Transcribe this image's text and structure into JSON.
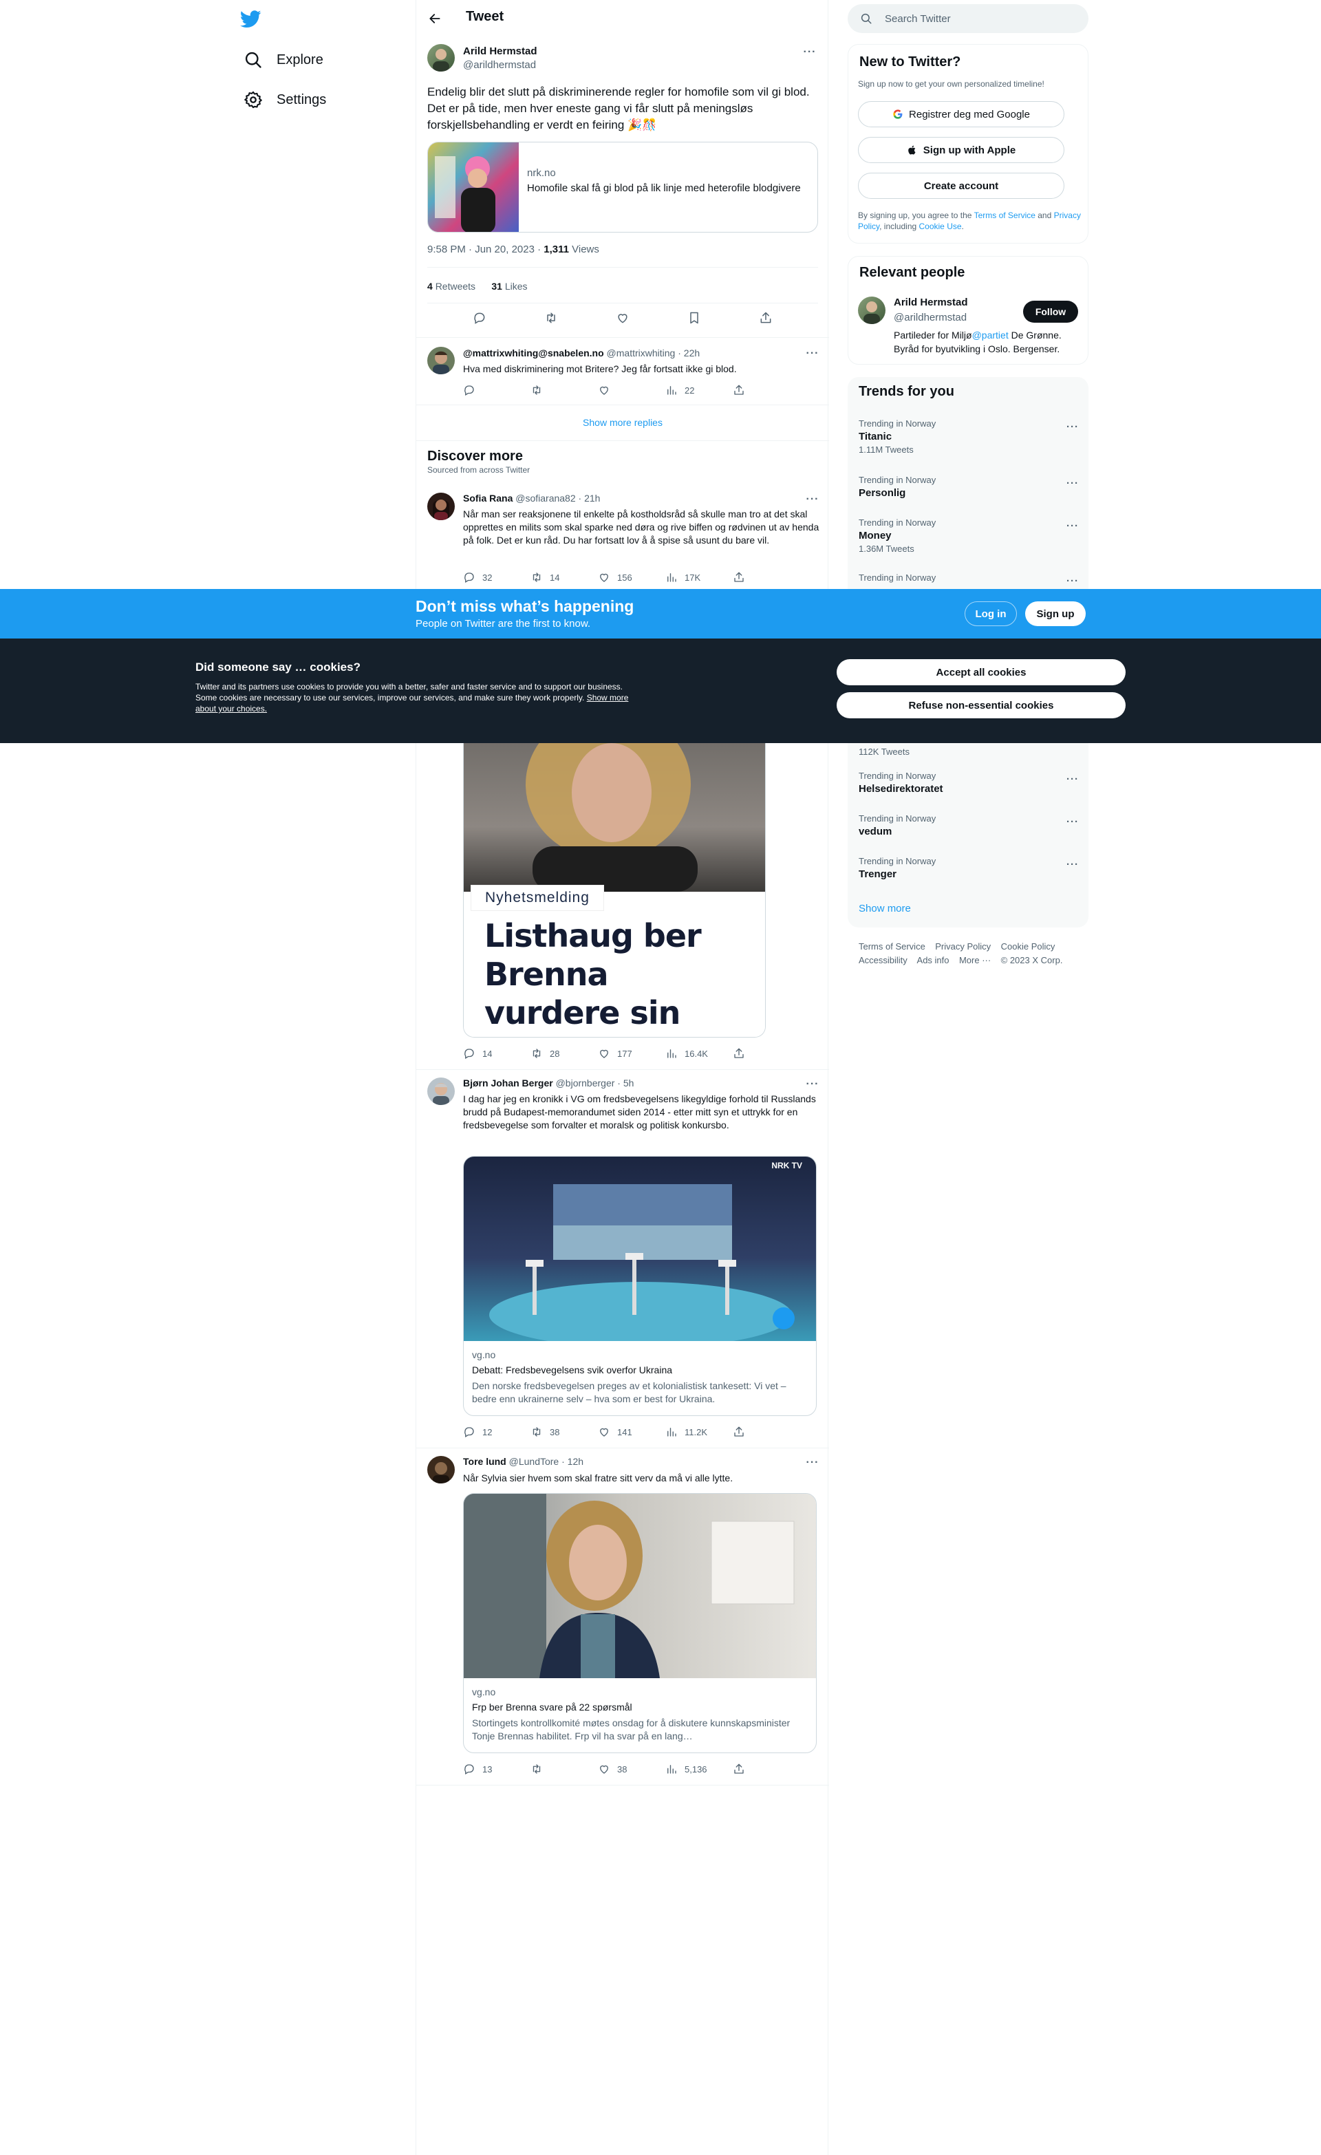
{
  "nav": {
    "explore": "Explore",
    "settings": "Settings"
  },
  "header": {
    "title": "Tweet"
  },
  "main_tweet": {
    "name": "Arild Hermstad",
    "handle": "@arildhermstad",
    "text": "Endelig blir det slutt på diskriminerende regler for homofile som vil gi blod. Det er på tide, men hver eneste gang vi får slutt på meningsløs forskjellsbehandling er verdt en feiring 🎉🎊",
    "card_domain": "nrk.no",
    "card_title": "Homofile skal få gi blod på lik linje med heterofile blodgivere",
    "time": "9:58 PM · Jun 20, 2023 · ",
    "views_count": "1,311",
    "views_label": " Views",
    "retweets_count": "4",
    "retweets_label": "Retweets",
    "likes_count": "31",
    "likes_label": "Likes"
  },
  "reply": {
    "name": "@mattrixwhiting@snabelen.no",
    "handle": "@mattrixwhiting · 22h",
    "text": "Hva med diskriminering mot Britere? Jeg får fortsatt ikke gi blod.",
    "views": "22"
  },
  "show_more_replies": "Show more replies",
  "discover": {
    "title": "Discover more",
    "subtitle": "Sourced from across Twitter"
  },
  "tweets": [
    {
      "name": "Sofia Rana",
      "handle": "@sofiarana82 · 21h",
      "text": "Når man ser reaksjonene til enkelte på kostholdsråd så skulle man tro at det skal opprettes en milits som skal sparke ned døra og rive biffen og rødvinen ut av henda på folk. Det er kun råd. Du har fortsatt lov å å spise så usunt du bare vil.",
      "replies": "32",
      "retweets": "14",
      "likes": "156",
      "views": "17K"
    },
    {
      "image_tag": "Nyhetsmelding",
      "image_headline": "Listhaug ber Brenna vurdere sin stilling",
      "replies": "14",
      "retweets": "28",
      "likes": "177",
      "views": "16.4K"
    },
    {
      "name": "Bjørn Johan Berger",
      "handle": "@bjornberger · 5h",
      "text": "I dag har jeg en kronikk i VG om fredsbevegelsens likegyldige forhold til Russlands brudd på Budapest-memorandumet siden 2014 - etter mitt syn et uttrykk for en fredsbevegelse som forvalter et moralsk og politisk konkursbo.",
      "card_domain": "vg.no",
      "card_title": "Debatt: Fredsbevegelsens svik overfor Ukraina",
      "card_desc": "Den norske fredsbevegelsen preges av et kolonialistisk tankesett: Vi vet – bedre enn ukrainerne selv – hva som er best for Ukraina.",
      "image_brand": "NRK TV",
      "replies": "12",
      "retweets": "38",
      "likes": "141",
      "views": "11.2K"
    },
    {
      "name": "Tore lund",
      "handle": "@LundTore · 12h",
      "text": "Når Sylvia sier hvem som skal fratre sitt verv da må vi alle lytte.",
      "card_domain": "vg.no",
      "card_title": "Frp ber Brenna svare på 22 spørsmål",
      "card_desc": "Stortingets kontrollkomité møtes onsdag for å diskutere kunnskapsminister Tonje Brennas habilitet. Frp vil ha svar på en lang…",
      "replies": "13",
      "retweets": "",
      "likes": "38",
      "views": "5,136"
    }
  ],
  "right": {
    "search_placeholder": "Search Twitter",
    "new_title": "New to Twitter?",
    "new_sub": "Sign up now to get your own personalized timeline!",
    "google_btn": "Registrer deg med Google",
    "apple_btn": "Sign up with Apple",
    "create_btn": "Create account",
    "terms_pre": "By signing up, you agree to the ",
    "terms_link": "Terms of Service",
    "terms_mid": " and ",
    "privacy_link": "Privacy Policy",
    "terms_mid2": ", including ",
    "cookie_link": "Cookie Use",
    "terms_end": ".",
    "relevant_title": "Relevant people",
    "person_name": "Arild Hermstad",
    "person_handle": "@arildhermstad",
    "follow_btn": "Follow",
    "bio_pre": "Partileder for Miljø",
    "bio_link": "@partiet",
    "bio_post": " De Grønne. Byråd for byutvikling i Oslo. Bergenser.",
    "trends_title": "Trends for you",
    "trends": [
      {
        "cat": "Trending in Norway",
        "title": "Titanic",
        "count": "1.11M Tweets"
      },
      {
        "cat": "Trending in Norway",
        "title": "Personlig",
        "count": ""
      },
      {
        "cat": "Trending in Norway",
        "title": "Money",
        "count": "1.36M Tweets"
      },
      {
        "cat": "Trending in Norway",
        "title": "",
        "count": ""
      },
      {
        "cat": "",
        "title": "",
        "count": "112K Tweets"
      },
      {
        "cat": "Trending in Norway",
        "title": "Helsedirektoratet",
        "count": ""
      },
      {
        "cat": "Trending in Norway",
        "title": "vedum",
        "count": ""
      },
      {
        "cat": "Trending in Norway",
        "title": "Trenger",
        "count": ""
      }
    ],
    "show_more": "Show more",
    "footer_line1": [
      "Terms of Service",
      "Privacy Policy",
      "Cookie Policy"
    ],
    "footer_line2": [
      "Accessibility",
      "Ads info",
      "More ···",
      "© 2023 X Corp."
    ]
  },
  "signup_bar": {
    "title": "Don’t miss what’s happening",
    "sub": "People on Twitter are the first to know.",
    "login": "Log in",
    "signup": "Sign up"
  },
  "cookie_bar": {
    "title": "Did someone say … cookies?",
    "text": "Twitter and its partners use cookies to provide you with a better, safer and faster service and to support our business. Some cookies are necessary to use our services, improve our services, and make sure they work properly. ",
    "link": "Show more about your choices.",
    "accept": "Accept all cookies",
    "refuse": "Refuse non-essential cookies"
  },
  "colors": {
    "accent": "#1d9bf0",
    "dark": "#15202b",
    "text": "#0f1419",
    "muted": "#536471"
  }
}
